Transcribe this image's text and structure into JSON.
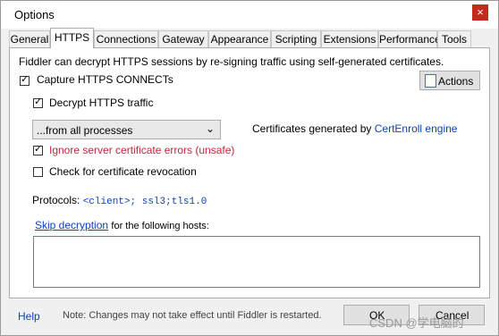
{
  "window": {
    "title": "Options",
    "close_glyph": "×"
  },
  "tabs": [
    {
      "label": "General"
    },
    {
      "label": "HTTPS",
      "active": true
    },
    {
      "label": "Connections"
    },
    {
      "label": "Gateway"
    },
    {
      "label": "Appearance"
    },
    {
      "label": "Scripting"
    },
    {
      "label": "Extensions"
    },
    {
      "label": "Performance"
    },
    {
      "label": "Tools"
    }
  ],
  "https": {
    "intro": "Fiddler can decrypt HTTPS sessions by re-signing traffic using self-generated certificates.",
    "capture_label": "Capture HTTPS CONNECTs",
    "actions_button": "Actions",
    "decrypt_label": "Decrypt HTTPS traffic",
    "process_select": "...from all processes",
    "cert_prefix": "Certificates generated by",
    "cert_link": "CertEnroll engine",
    "ignore_label": "Ignore server certificate errors (unsafe)",
    "revocation_label": "Check for certificate revocation",
    "protocols_label": "Protocols:",
    "protocols_value": "<client>; ssl3;tls1.0",
    "skip_link": "Skip decryption",
    "skip_suffix": "for the following hosts:",
    "skip_hosts_value": "",
    "capture_checked": true,
    "decrypt_checked": true,
    "ignore_checked": true,
    "revocation_checked": false
  },
  "footer": {
    "help": "Help",
    "note": "Note: Changes may not take effect until Fiddler is restarted.",
    "ok": "OK",
    "cancel": "Cancel",
    "watermark": "CSDN @学电脑的"
  },
  "icons": {
    "close": "close-icon",
    "actions": "certificate-actions-icon",
    "chevron": "chevron-down-icon",
    "check": "check-icon"
  },
  "colors": {
    "link": "#0b43b7",
    "warning": "#c4263b",
    "close": "#c42b1c"
  }
}
